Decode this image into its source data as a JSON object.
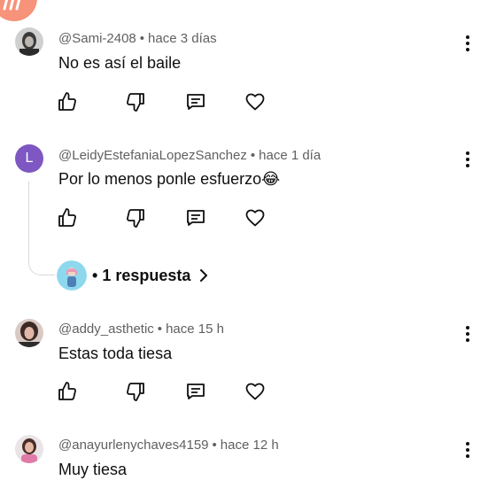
{
  "comments": [
    {
      "author": "@Sami-2408",
      "time": "hace 3 días",
      "text": "No es así el baile"
    },
    {
      "author": "@LeidyEstefaniaLopezSanchez",
      "time": "hace 1 día",
      "text": "Por lo menos ponle esfuerzo😂",
      "avatar_letter": "L",
      "avatar_color": "#7e57c2",
      "replies_label": "1 respuesta"
    },
    {
      "author": "@addy_asthetic",
      "time": "hace 15 h",
      "text": "Estas toda tiesa"
    },
    {
      "author": "@anayurlenychaves4159",
      "time": "hace 12 h",
      "text": "Muy tiesa"
    }
  ],
  "separator": "•",
  "icons": {
    "like": "thumbs-up-icon",
    "dislike": "thumbs-down-icon",
    "reply": "reply-comment-icon",
    "heart": "heart-icon",
    "menu": "more-vertical-icon"
  }
}
